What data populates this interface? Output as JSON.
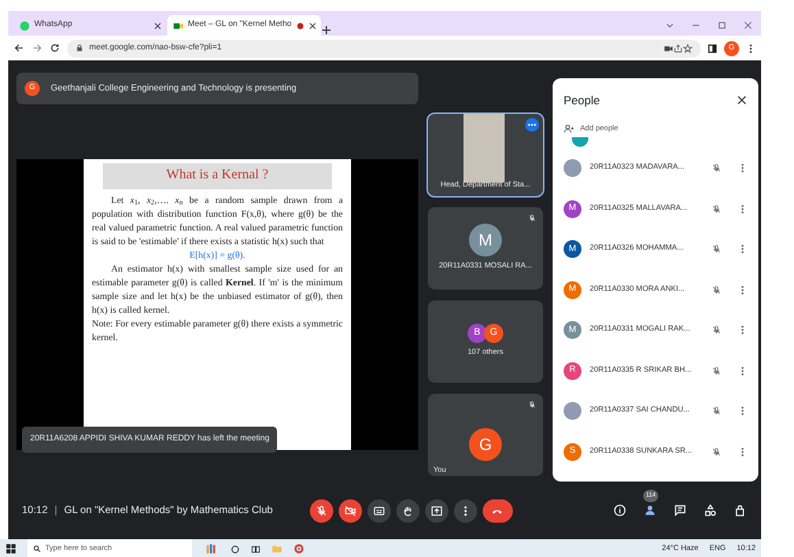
{
  "browser": {
    "tabs": [
      {
        "title": "WhatsApp",
        "kind": "whatsapp",
        "selected": false
      },
      {
        "title": "Meet – GL on \"Kernel Metho",
        "kind": "meet",
        "selected": true
      }
    ],
    "address": "meet.google.com/nao-bsw-cfe?pli=1",
    "profile": "G"
  },
  "banner": {
    "avatar": "G",
    "text": "Geethanjali College Engineering and Technology is presenting"
  },
  "slide": {
    "title": "What is a Kernal ?",
    "paragraphs": [
      {
        "kind": "indent",
        "text": "Let *x*$_{1}$, *x*$_{2}$,…. *x*$_{n}$ be a random sample drawn from a population with distribution function F(x,θ), where g(θ) be the real valued parametric function. A real valued parametric function is said to be 'estimable' if there exists a statistic h(x) such that"
      },
      {
        "kind": "formula",
        "text": "E[h(x)] = g(θ)."
      },
      {
        "kind": "indent",
        "text": "An estimator h(x) with smallest sample size used for an estimable parameter g(θ) is called **Kernel**. If 'm' is the minimum sample size and let h(x) be the unbiased estimator of g(θ), then h(x) is called kernel."
      },
      {
        "kind": "plain",
        "text": "Note: For every estimable parameter g(θ) there exists a symmetric kernel."
      }
    ]
  },
  "toast": "20R11A6208 APPIDI SHIVA KUMAR REDDY has left the meeting",
  "tiles": [
    {
      "kind": "video",
      "label": "Head, Department of Sta...",
      "muted": false,
      "selected": true
    },
    {
      "kind": "avatar",
      "avatars": [
        {
          "letter": "M",
          "color": "#78909c"
        }
      ],
      "label": "20R11A0331 MOSALI RA...",
      "muted": true,
      "selected": false
    },
    {
      "kind": "group",
      "avatars": [
        {
          "letter": "B",
          "color": "#a142c5"
        },
        {
          "letter": "G",
          "color": "#f4511e"
        }
      ],
      "label": "107 others",
      "muted": false,
      "selected": false
    },
    {
      "kind": "avatar",
      "avatars": [
        {
          "letter": "G",
          "color": "#f4511e"
        }
      ],
      "label": "You",
      "muted": true,
      "selected": false
    }
  ],
  "people": {
    "title": "People",
    "add": "Add people",
    "rows": [
      {
        "kind": "photo",
        "name": "20R11A0323 MADAVARA...",
        "muted": true
      },
      {
        "kind": "letter",
        "letter": "M",
        "color": "#a142c5",
        "name": "20R11A0325 MALLAVARA...",
        "muted": true
      },
      {
        "kind": "letter",
        "letter": "M",
        "color": "#0b57a0",
        "name": "20R11A0326 MOHAMMA...",
        "muted": true
      },
      {
        "kind": "letter",
        "letter": "M",
        "color": "#ef6c00",
        "name": "20R11A0330 MORA ANKI...",
        "muted": true
      },
      {
        "kind": "letter",
        "letter": "M",
        "color": "#78909c",
        "name": "20R11A0331 MOGALI RAK...",
        "muted": true
      },
      {
        "kind": "letter",
        "letter": "R",
        "color": "#e8457c",
        "name": "20R11A0335 R SRIKAR BH...",
        "muted": true
      },
      {
        "kind": "photo",
        "name": "20R11A0337 SAI CHANDU...",
        "muted": true
      },
      {
        "kind": "letter",
        "letter": "S",
        "color": "#ef6c00",
        "name": "20R11A0338 SUNKARA SR...",
        "muted": true
      }
    ]
  },
  "bottom": {
    "time": "10:12",
    "separator": "|",
    "title": "GL on \"Kernel Methods\" by Mathematics Club",
    "controls": [
      {
        "kind": "mic",
        "on": false
      },
      {
        "kind": "cam",
        "on": false
      },
      {
        "kind": "captions",
        "on": false
      },
      {
        "kind": "hand",
        "on": false
      },
      {
        "kind": "present",
        "on": false
      },
      {
        "kind": "more",
        "on": false
      },
      {
        "kind": "end",
        "on": true
      }
    ],
    "people_count": "114"
  },
  "taskbar": {
    "search": "Type here to search",
    "weather": "24°C Haze",
    "lang": "ENG",
    "time": "10:12"
  }
}
